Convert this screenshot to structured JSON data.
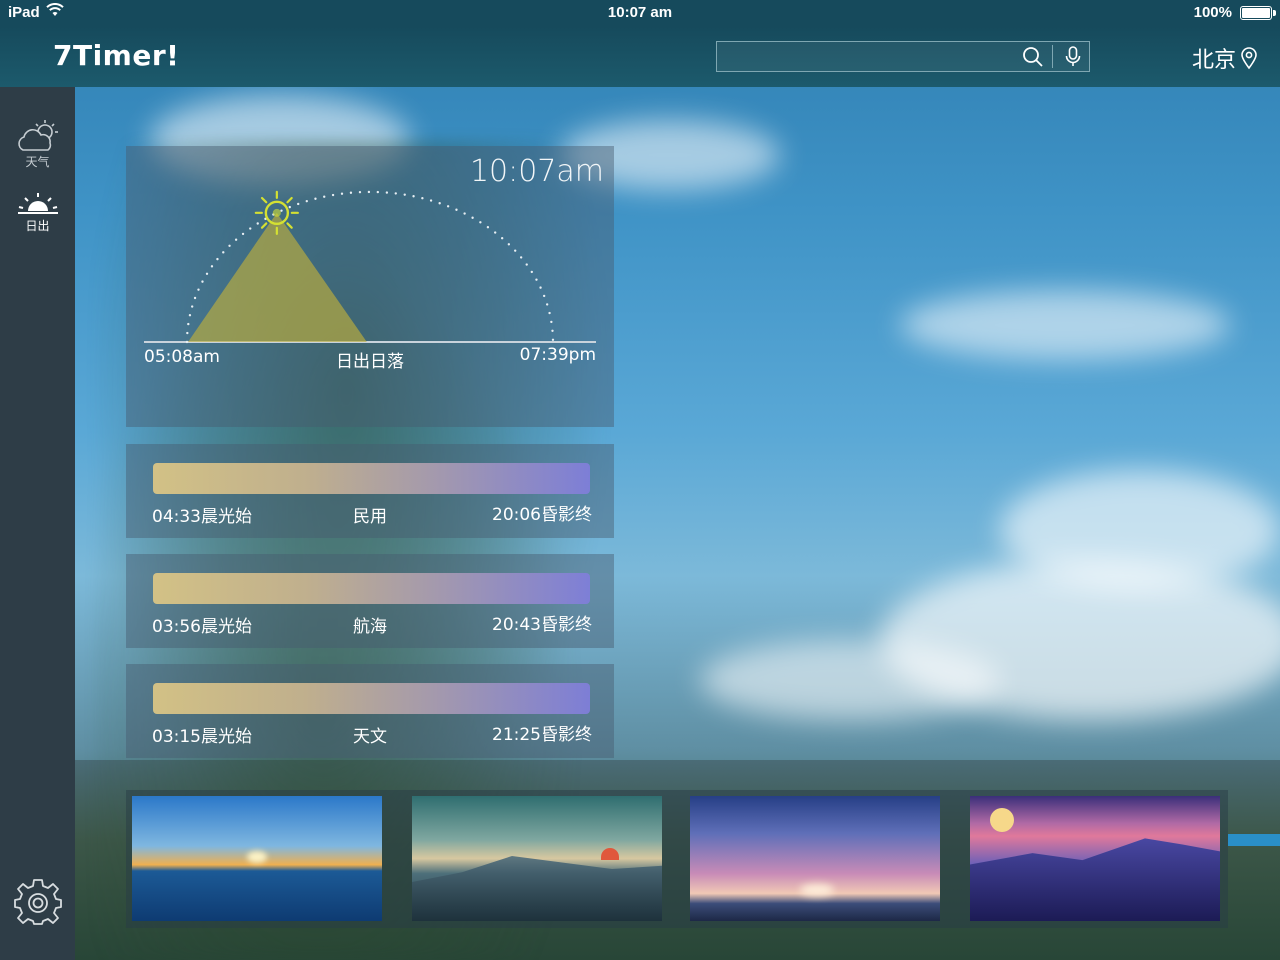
{
  "status_bar": {
    "device": "iPad",
    "time": "10:07 am",
    "battery": "100%"
  },
  "header": {
    "app_title": "7Timer!",
    "search": {
      "value": "",
      "placeholder": ""
    },
    "location": "北京"
  },
  "sidebar": {
    "items": [
      {
        "label": "天气",
        "icon": "cloud-sun-icon",
        "active": false
      },
      {
        "label": "日出",
        "icon": "sunrise-icon",
        "active": true
      }
    ],
    "settings_icon": "gear-icon"
  },
  "sun_panel": {
    "clock": "10:07am",
    "sunrise": "05:08am",
    "title": "日出日落",
    "sunset": "07:39pm",
    "day_progress": 0.33
  },
  "twilight": [
    {
      "dawn": "04:33晨光始",
      "type": "民用",
      "dusk": "20:06昏影终"
    },
    {
      "dawn": "03:56晨光始",
      "type": "航海",
      "dusk": "20:43昏影终"
    },
    {
      "dawn": "03:15晨光始",
      "type": "天文",
      "dusk": "21:25昏影终"
    }
  ],
  "colors": {
    "header": "#164a5c",
    "sidebar": "#2e3d47",
    "sun": "#d4e032",
    "twilight_start": "#d9c585",
    "twilight_end": "#7f7ed9"
  },
  "thumbnails": [
    "sunset-over-sea",
    "mountain-sunrise",
    "dramatic-sky-sunset",
    "purple-mountain-sunset"
  ]
}
